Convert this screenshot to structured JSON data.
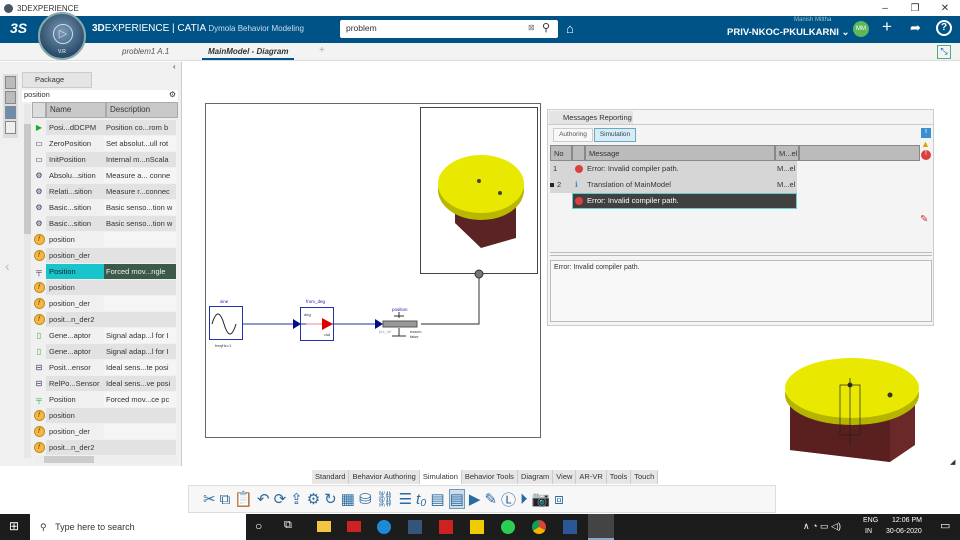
{
  "window": {
    "title": "3DEXPERIENCE"
  },
  "header": {
    "brand_bold": "3D",
    "brand": "EXPERIENCE | CATIA",
    "app": "Dymola Behavior Modeling",
    "search_value": "problem",
    "user_name": "Manish Mittha",
    "tenant": "PRIV-NKOC-PKULKARNI",
    "avatar": "MM",
    "compass_labels": [
      "V.R"
    ]
  },
  "tabs": [
    {
      "label": "problem1 A.1"
    },
    {
      "label": "MainModel - Diagram"
    },
    {
      "label": "+"
    }
  ],
  "package_browser": {
    "title": "Package Browser",
    "search": "position",
    "columns": [
      "Name",
      "Description"
    ],
    "rows": [
      {
        "icon": "play",
        "name": "Posi...dDCPM",
        "desc": "Position co...rom b"
      },
      {
        "icon": "block",
        "name": "ZeroPosition",
        "desc": "Set absolut...ull rot"
      },
      {
        "icon": "block",
        "name": "InitPosition",
        "desc": "Internal m...nScala"
      },
      {
        "icon": "sensor",
        "name": "Absolu...sition",
        "desc": "Measure a... conne"
      },
      {
        "icon": "sensor",
        "name": "Relati...sition",
        "desc": "Measure r...connec"
      },
      {
        "icon": "sensor",
        "name": "Basic...sition",
        "desc": "Basic senso...tion w"
      },
      {
        "icon": "sensor",
        "name": "Basic...sition",
        "desc": "Basic senso...tion w"
      },
      {
        "icon": "f",
        "name": "position",
        "desc": ""
      },
      {
        "icon": "f",
        "name": "position_der",
        "desc": ""
      },
      {
        "icon": "flange",
        "name": "Position",
        "desc": "Forced mov...ngle"
      },
      {
        "icon": "f",
        "name": "position",
        "desc": ""
      },
      {
        "icon": "f",
        "name": "position_der",
        "desc": ""
      },
      {
        "icon": "f",
        "name": "posit...n_der2",
        "desc": ""
      },
      {
        "icon": "adaptor",
        "name": "Gene...aptor",
        "desc": "Signal adap...l for I"
      },
      {
        "icon": "adaptor",
        "name": "Gene...aptor",
        "desc": "Signal adap...l for I"
      },
      {
        "icon": "tsensor",
        "name": "Posit...ensor",
        "desc": "Ideal sens...te posi"
      },
      {
        "icon": "tsensor",
        "name": "RelPo...Sensor",
        "desc": "Ideal sens...ve posi"
      },
      {
        "icon": "tflange",
        "name": "Position",
        "desc": "Forced mov...ce pc"
      },
      {
        "icon": "f",
        "name": "position",
        "desc": ""
      },
      {
        "icon": "f",
        "name": "position_der",
        "desc": ""
      },
      {
        "icon": "f",
        "name": "posit...n_der2",
        "desc": ""
      }
    ],
    "selected_index": 9
  },
  "diagram": {
    "blocks": [
      {
        "name": "sine",
        "param": "freqHz=1"
      },
      {
        "name": "from_deg",
        "in": "deg",
        "out": "rad"
      },
      {
        "name": "position",
        "port": "phi_ref",
        "param": "exact=\nfalse"
      }
    ]
  },
  "messages": {
    "title": "Messages Reporting",
    "tabs": [
      "Authoring",
      "Simulation"
    ],
    "active_tab": "Simulation",
    "columns": [
      "No",
      "",
      "Message",
      "M...el"
    ],
    "rows": [
      {
        "no": "1",
        "type": "error",
        "message": "Error: Invalid compiler path.",
        "model": "M...el"
      },
      {
        "no": "2",
        "type": "info",
        "message": "Translation of MainModel",
        "model": "M...el"
      },
      {
        "no": "",
        "type": "error",
        "message": "Error: Invalid compiler path.",
        "model": ""
      }
    ],
    "detail": "Error: Invalid compiler path."
  },
  "toolbar": {
    "tabs": [
      "Standard",
      "Behavior Authoring",
      "Simulation",
      "Behavior Tools",
      "Diagram",
      "View",
      "AR-VR",
      "Tools",
      "Touch"
    ],
    "active": "Simulation"
  },
  "taskbar": {
    "search_placeholder": "Type here to search",
    "lang": "ENG",
    "region": "IN",
    "time": "12:06 PM",
    "date": "30-06-2020"
  },
  "colors": {
    "header": "#005386",
    "selection": "#18c5cc",
    "error": "#d9413a",
    "model_yellow": "#e6e600",
    "model_base": "#6b2a2a"
  }
}
